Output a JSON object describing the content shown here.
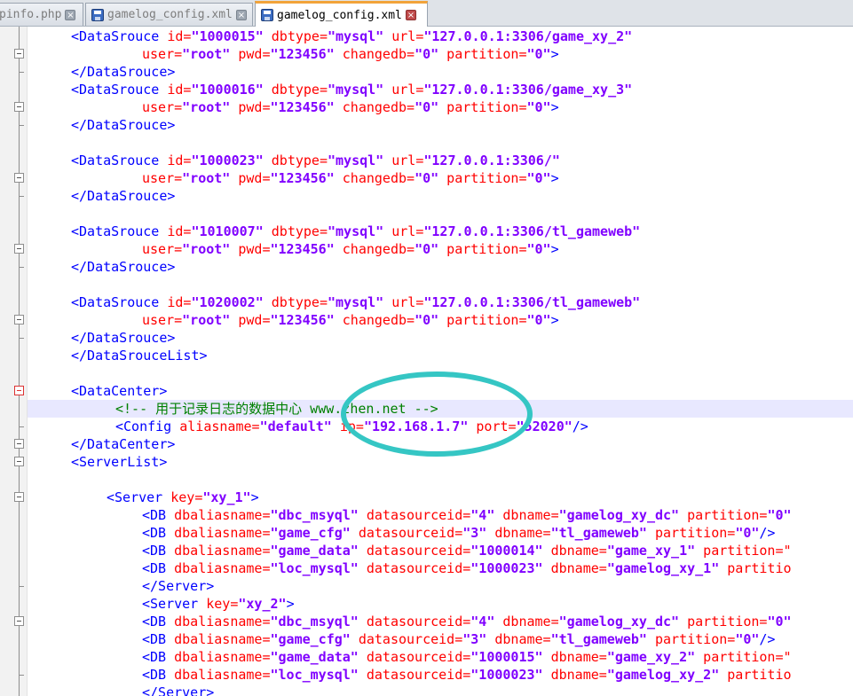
{
  "tabs": [
    {
      "label": "pinfo.php"
    },
    {
      "label": "gamelog_config.xml"
    },
    {
      "label": "gamelog_config.xml"
    }
  ],
  "editor": {
    "lines": [
      {
        "indent": 4,
        "tokens": [
          [
            "t",
            "<DataSrouce"
          ],
          [
            "a",
            " id="
          ],
          [
            "v",
            "\"1000015\""
          ],
          [
            "a",
            " dbtype="
          ],
          [
            "v",
            "\"mysql\""
          ],
          [
            "a",
            " url="
          ],
          [
            "v",
            "\"127.0.0.1:3306/game_xy_2\""
          ]
        ]
      },
      {
        "indent": 12,
        "tokens": [
          [
            "a",
            "user="
          ],
          [
            "v",
            "\"root\""
          ],
          [
            "a",
            " pwd="
          ],
          [
            "v",
            "\"123456\""
          ],
          [
            "a",
            " changedb="
          ],
          [
            "v",
            "\"0\""
          ],
          [
            "a",
            " partition="
          ],
          [
            "v",
            "\"0\""
          ],
          [
            "t",
            ">"
          ]
        ]
      },
      {
        "indent": 4,
        "tokens": [
          [
            "t",
            "</DataSrouce>"
          ]
        ]
      },
      {
        "indent": 4,
        "tokens": [
          [
            "t",
            "<DataSrouce"
          ],
          [
            "a",
            " id="
          ],
          [
            "v",
            "\"1000016\""
          ],
          [
            "a",
            " dbtype="
          ],
          [
            "v",
            "\"mysql\""
          ],
          [
            "a",
            " url="
          ],
          [
            "v",
            "\"127.0.0.1:3306/game_xy_3\""
          ]
        ]
      },
      {
        "indent": 12,
        "tokens": [
          [
            "a",
            "user="
          ],
          [
            "v",
            "\"root\""
          ],
          [
            "a",
            " pwd="
          ],
          [
            "v",
            "\"123456\""
          ],
          [
            "a",
            " changedb="
          ],
          [
            "v",
            "\"0\""
          ],
          [
            "a",
            " partition="
          ],
          [
            "v",
            "\"0\""
          ],
          [
            "t",
            ">"
          ]
        ]
      },
      {
        "indent": 4,
        "tokens": [
          [
            "t",
            "</DataSrouce>"
          ]
        ]
      },
      {
        "indent": 0,
        "tokens": []
      },
      {
        "indent": 4,
        "tokens": [
          [
            "t",
            "<DataSrouce"
          ],
          [
            "a",
            " id="
          ],
          [
            "v",
            "\"1000023\""
          ],
          [
            "a",
            " dbtype="
          ],
          [
            "v",
            "\"mysql\""
          ],
          [
            "a",
            " url="
          ],
          [
            "v",
            "\"127.0.0.1:3306/\""
          ]
        ]
      },
      {
        "indent": 12,
        "tokens": [
          [
            "a",
            "user="
          ],
          [
            "v",
            "\"root\""
          ],
          [
            "a",
            " pwd="
          ],
          [
            "v",
            "\"123456\""
          ],
          [
            "a",
            " changedb="
          ],
          [
            "v",
            "\"0\""
          ],
          [
            "a",
            " partition="
          ],
          [
            "v",
            "\"0\""
          ],
          [
            "t",
            ">"
          ]
        ]
      },
      {
        "indent": 4,
        "tokens": [
          [
            "t",
            "</DataSrouce>"
          ]
        ]
      },
      {
        "indent": 0,
        "tokens": []
      },
      {
        "indent": 4,
        "tokens": [
          [
            "t",
            "<DataSrouce"
          ],
          [
            "a",
            " id="
          ],
          [
            "v",
            "\"1010007\""
          ],
          [
            "a",
            " dbtype="
          ],
          [
            "v",
            "\"mysql\""
          ],
          [
            "a",
            " url="
          ],
          [
            "v",
            "\"127.0.0.1:3306/tl_gameweb\""
          ]
        ]
      },
      {
        "indent": 12,
        "tokens": [
          [
            "a",
            "user="
          ],
          [
            "v",
            "\"root\""
          ],
          [
            "a",
            " pwd="
          ],
          [
            "v",
            "\"123456\""
          ],
          [
            "a",
            " changedb="
          ],
          [
            "v",
            "\"0\""
          ],
          [
            "a",
            " partition="
          ],
          [
            "v",
            "\"0\""
          ],
          [
            "t",
            ">"
          ]
        ]
      },
      {
        "indent": 4,
        "tokens": [
          [
            "t",
            "</DataSrouce>"
          ]
        ]
      },
      {
        "indent": 0,
        "tokens": []
      },
      {
        "indent": 4,
        "tokens": [
          [
            "t",
            "<DataSrouce"
          ],
          [
            "a",
            " id="
          ],
          [
            "v",
            "\"1020002\""
          ],
          [
            "a",
            " dbtype="
          ],
          [
            "v",
            "\"mysql\""
          ],
          [
            "a",
            " url="
          ],
          [
            "v",
            "\"127.0.0.1:3306/tl_gameweb\""
          ]
        ]
      },
      {
        "indent": 12,
        "tokens": [
          [
            "a",
            "user="
          ],
          [
            "v",
            "\"root\""
          ],
          [
            "a",
            " pwd="
          ],
          [
            "v",
            "\"123456\""
          ],
          [
            "a",
            " changedb="
          ],
          [
            "v",
            "\"0\""
          ],
          [
            "a",
            " partition="
          ],
          [
            "v",
            "\"0\""
          ],
          [
            "t",
            ">"
          ]
        ]
      },
      {
        "indent": 4,
        "tokens": [
          [
            "t",
            "</DataSrouce>"
          ]
        ]
      },
      {
        "indent": 4,
        "tokens": [
          [
            "t",
            "</DataSrouceList>"
          ]
        ]
      },
      {
        "indent": 0,
        "tokens": []
      },
      {
        "indent": 4,
        "tokens": [
          [
            "t",
            "<DataCenter>"
          ]
        ]
      },
      {
        "indent": 9,
        "current": true,
        "tokens": [
          [
            "c",
            "<!-- 用于记录日志的数据中心 www.zhen.net -->"
          ]
        ]
      },
      {
        "indent": 9,
        "tokens": [
          [
            "t",
            "<Config"
          ],
          [
            "a",
            " aliasname="
          ],
          [
            "v",
            "\"default\""
          ],
          [
            "a",
            " ip="
          ],
          [
            "v",
            "\"192.168.1.7\""
          ],
          [
            "a",
            " port="
          ],
          [
            "v",
            "\"52020\""
          ],
          [
            "t",
            "/>"
          ]
        ]
      },
      {
        "indent": 4,
        "tokens": [
          [
            "t",
            "</DataCenter>"
          ]
        ]
      },
      {
        "indent": 4,
        "tokens": [
          [
            "t",
            "<ServerList>"
          ]
        ]
      },
      {
        "indent": 0,
        "tokens": []
      },
      {
        "indent": 8,
        "tokens": [
          [
            "t",
            "<Server"
          ],
          [
            "a",
            " key="
          ],
          [
            "v",
            "\"xy_1\""
          ],
          [
            "t",
            ">"
          ]
        ]
      },
      {
        "indent": 12,
        "tokens": [
          [
            "t",
            "<DB"
          ],
          [
            "a",
            " dbaliasname="
          ],
          [
            "v",
            "\"dbc_msyql\""
          ],
          [
            "a",
            " datasourceid="
          ],
          [
            "v",
            "\"4\""
          ],
          [
            "a",
            " dbname="
          ],
          [
            "v",
            "\"gamelog_xy_dc\""
          ],
          [
            "a",
            " partition="
          ],
          [
            "v",
            "\"0\""
          ]
        ]
      },
      {
        "indent": 12,
        "tokens": [
          [
            "t",
            "<DB"
          ],
          [
            "a",
            " dbaliasname="
          ],
          [
            "v",
            "\"game_cfg\""
          ],
          [
            "a",
            " datasourceid="
          ],
          [
            "v",
            "\"3\""
          ],
          [
            "a",
            " dbname="
          ],
          [
            "v",
            "\"tl_gameweb\""
          ],
          [
            "a",
            " partition="
          ],
          [
            "v",
            "\"0\""
          ],
          [
            "t",
            "/>"
          ]
        ]
      },
      {
        "indent": 12,
        "tokens": [
          [
            "t",
            "<DB"
          ],
          [
            "a",
            " dbaliasname="
          ],
          [
            "v",
            "\"game_data\""
          ],
          [
            "a",
            " datasourceid="
          ],
          [
            "v",
            "\"1000014\""
          ],
          [
            "a",
            " dbname="
          ],
          [
            "v",
            "\"game_xy_1\""
          ],
          [
            "a",
            " partition=\""
          ]
        ]
      },
      {
        "indent": 12,
        "tokens": [
          [
            "t",
            "<DB"
          ],
          [
            "a",
            " dbaliasname="
          ],
          [
            "v",
            "\"loc_mysql\""
          ],
          [
            "a",
            " datasourceid="
          ],
          [
            "v",
            "\"1000023\""
          ],
          [
            "a",
            " dbname="
          ],
          [
            "v",
            "\"gamelog_xy_1\""
          ],
          [
            "a",
            " partitio"
          ]
        ]
      },
      {
        "indent": 12,
        "tokens": [
          [
            "t",
            "</Server>"
          ]
        ]
      },
      {
        "indent": 12,
        "tokens": [
          [
            "t",
            "<Server"
          ],
          [
            "a",
            " key="
          ],
          [
            "v",
            "\"xy_2\""
          ],
          [
            "t",
            ">"
          ]
        ]
      },
      {
        "indent": 12,
        "tokens": [
          [
            "t",
            "<DB"
          ],
          [
            "a",
            " dbaliasname="
          ],
          [
            "v",
            "\"dbc_msyql\""
          ],
          [
            "a",
            " datasourceid="
          ],
          [
            "v",
            "\"4\""
          ],
          [
            "a",
            " dbname="
          ],
          [
            "v",
            "\"gamelog_xy_dc\""
          ],
          [
            "a",
            " partition="
          ],
          [
            "v",
            "\"0\""
          ]
        ]
      },
      {
        "indent": 12,
        "tokens": [
          [
            "t",
            "<DB"
          ],
          [
            "a",
            " dbaliasname="
          ],
          [
            "v",
            "\"game_cfg\""
          ],
          [
            "a",
            " datasourceid="
          ],
          [
            "v",
            "\"3\""
          ],
          [
            "a",
            " dbname="
          ],
          [
            "v",
            "\"tl_gameweb\""
          ],
          [
            "a",
            " partition="
          ],
          [
            "v",
            "\"0\""
          ],
          [
            "t",
            "/>"
          ]
        ]
      },
      {
        "indent": 12,
        "tokens": [
          [
            "t",
            "<DB"
          ],
          [
            "a",
            " dbaliasname="
          ],
          [
            "v",
            "\"game_data\""
          ],
          [
            "a",
            " datasourceid="
          ],
          [
            "v",
            "\"1000015\""
          ],
          [
            "a",
            " dbname="
          ],
          [
            "v",
            "\"game_xy_2\""
          ],
          [
            "a",
            " partition=\""
          ]
        ]
      },
      {
        "indent": 12,
        "tokens": [
          [
            "t",
            "<DB"
          ],
          [
            "a",
            " dbaliasname="
          ],
          [
            "v",
            "\"loc_mysql\""
          ],
          [
            "a",
            " datasourceid="
          ],
          [
            "v",
            "\"1000023\""
          ],
          [
            "a",
            " dbname="
          ],
          [
            "v",
            "\"gamelog_xy_2\""
          ],
          [
            "a",
            " partitio"
          ]
        ]
      },
      {
        "indent": 12,
        "tokens": [
          [
            "t",
            "</Server>"
          ]
        ]
      }
    ]
  },
  "colors": {
    "tag": "#0000ff",
    "attribute": "#ff0000",
    "value": "#8000ff",
    "comment": "#008000",
    "active_tab_accent": "#f2a33a",
    "annotation_circle": "#35c6c4"
  },
  "icons": {
    "tab_file": "floppy-disk-icon",
    "tab_close": "close-x-icon",
    "fold": "fold-minus-icon"
  }
}
